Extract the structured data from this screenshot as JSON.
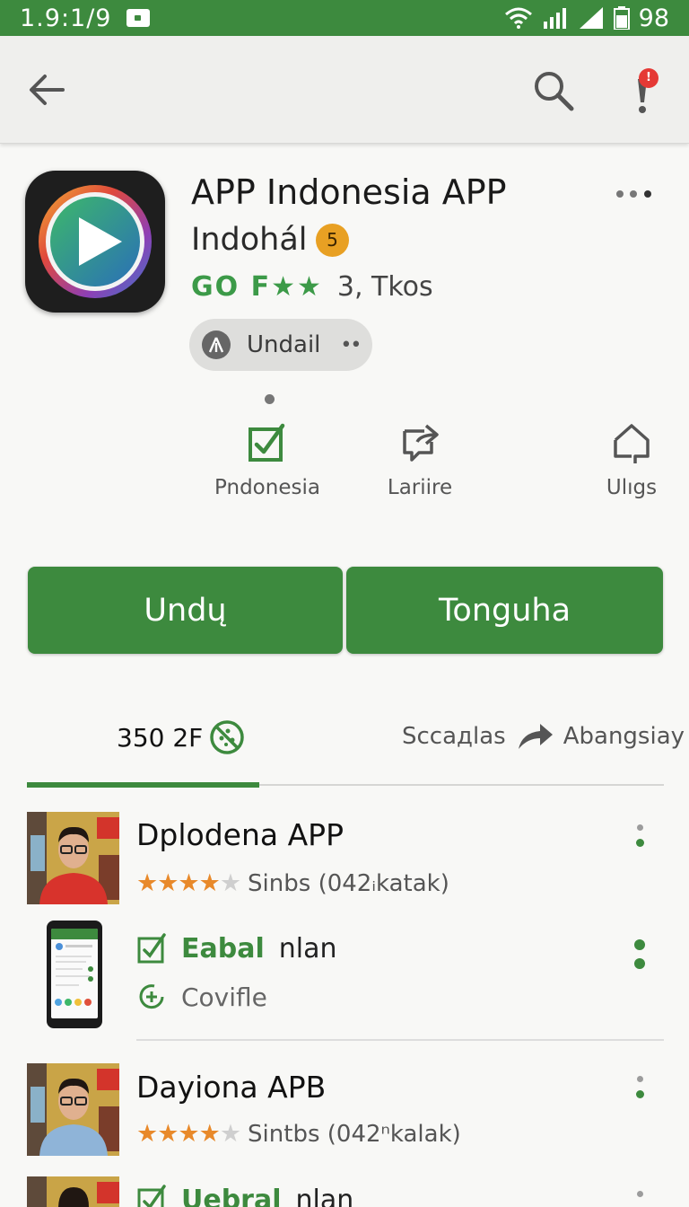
{
  "status_bar": {
    "time": "1.9:1/9",
    "battery": "98"
  },
  "app": {
    "title": "APP Indonesia APP",
    "developer": "Indohál",
    "developer_badge": "5",
    "rating_badge": "GO F★★",
    "downloads": "3, Tkos",
    "chip_label": "Undail",
    "chip_dots": "••"
  },
  "actions": [
    {
      "label": "Pndonesia",
      "icon": "checkbox-icon"
    },
    {
      "label": "Lariire",
      "icon": "share-chat-icon"
    },
    {
      "label": "Ulıgs",
      "icon": "home-icon"
    }
  ],
  "buttons": {
    "primary": "Undų",
    "secondary": "Tonguha"
  },
  "tabs": {
    "left": "350 2F",
    "right_1": "Sccaдlas",
    "right_2": "Abangsiay"
  },
  "list": [
    {
      "title": "Dplodena APP",
      "stars": "★★★★",
      "star_empty": "★",
      "rating_text": "Sinbs (042ᵢkatak)"
    },
    {
      "sub_green": "Eabal",
      "sub_dark": "nlan",
      "sub_gray": "Covifle"
    },
    {
      "title": "Dayiona APB",
      "stars": "★★★★",
      "star_empty": "★",
      "rating_text": "Sintbs (042ⁿkalak)"
    },
    {
      "sub_green": "Uebral",
      "sub_dark": "nlan"
    }
  ],
  "colors": {
    "primary_green": "#3d8a3e",
    "badge_red": "#e53935",
    "star_orange": "#e8892a"
  }
}
